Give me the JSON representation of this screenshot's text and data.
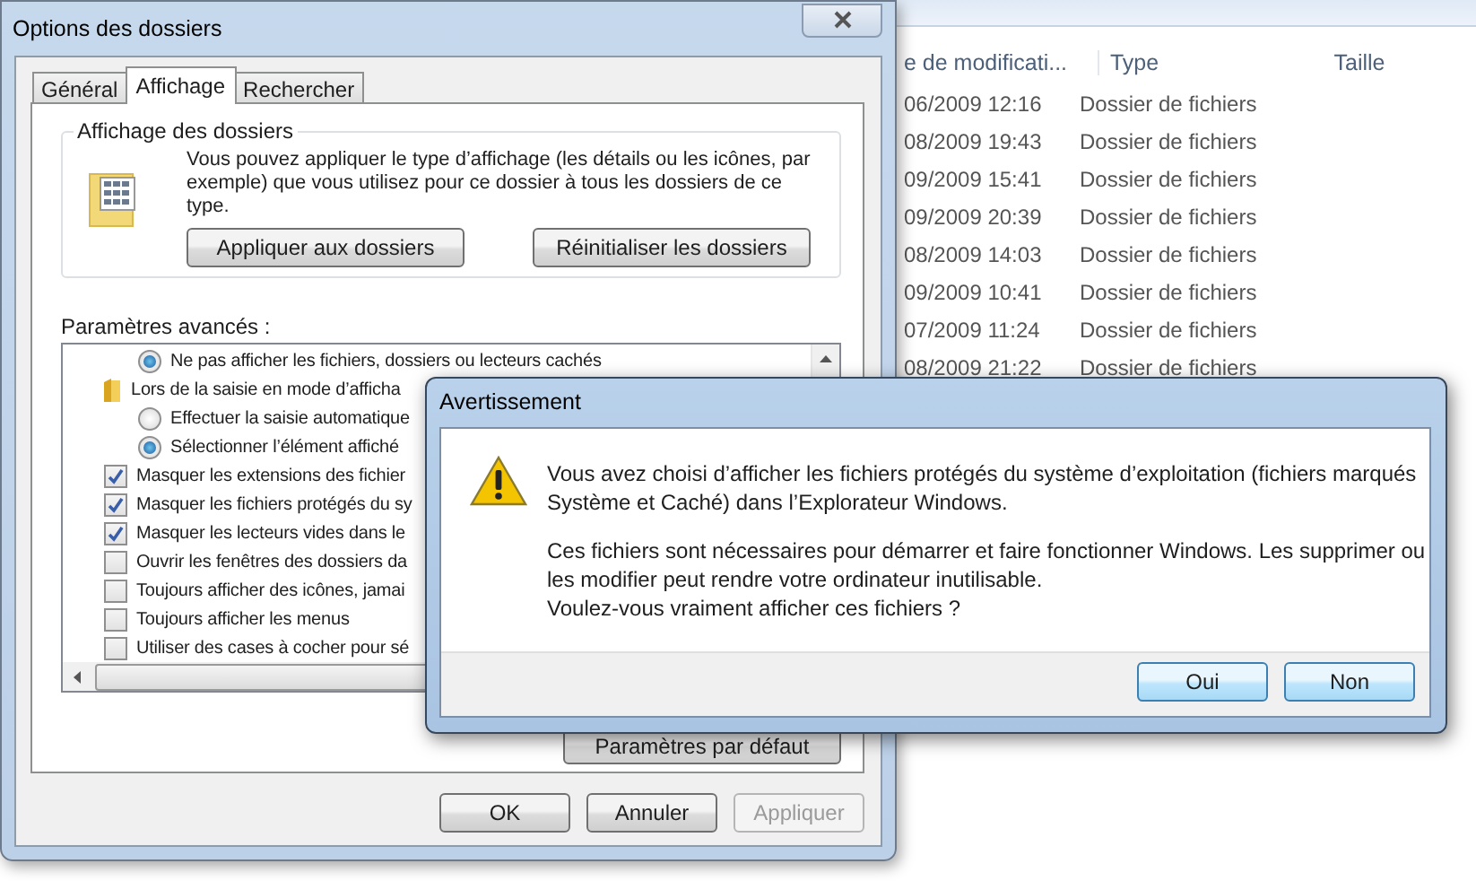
{
  "explorer": {
    "columns": [
      "e de modificati...",
      "Type",
      "Taille"
    ],
    "rows": [
      {
        "date": "06/2009 12:16",
        "type": "Dossier de fichiers"
      },
      {
        "date": "08/2009 19:43",
        "type": "Dossier de fichiers"
      },
      {
        "date": "09/2009 15:41",
        "type": "Dossier de fichiers"
      },
      {
        "date": "09/2009 20:39",
        "type": "Dossier de fichiers"
      },
      {
        "date": "08/2009 14:03",
        "type": "Dossier de fichiers"
      },
      {
        "date": "09/2009 10:41",
        "type": "Dossier de fichiers"
      },
      {
        "date": "07/2009 11:24",
        "type": "Dossier de fichiers"
      },
      {
        "date": "08/2009 21:22",
        "type": "Dossier de fichiers"
      }
    ]
  },
  "folder_options": {
    "title": "Options des dossiers",
    "tabs": [
      {
        "label": "Général",
        "selected": false
      },
      {
        "label": "Affichage",
        "selected": true
      },
      {
        "label": "Rechercher",
        "selected": false
      }
    ],
    "group": {
      "title": "Affichage des dossiers",
      "text": "Vous pouvez appliquer le type d’affichage (les détails ou les icônes, par exemple) que vous utilisez pour ce dossier à tous les dossiers de ce type.",
      "buttons": [
        "Appliquer aux dossiers",
        "Réinitialiser les dossiers"
      ]
    },
    "advanced_label": "Paramètres avancés :",
    "settings": [
      {
        "kind": "radio",
        "label": "Ne pas afficher les fichiers, dossiers ou lecteurs cachés",
        "checked": true
      },
      {
        "kind": "folder",
        "label": "Lors de la saisie en mode d’afficha"
      },
      {
        "kind": "radio",
        "label": "Effectuer la saisie automatique",
        "checked": false
      },
      {
        "kind": "radio",
        "label": "Sélectionner l’élément affiché",
        "checked": true
      },
      {
        "kind": "checkbox",
        "label": "Masquer les extensions des fichier",
        "checked": true
      },
      {
        "kind": "checkbox",
        "label": "Masquer les fichiers protégés du sy",
        "checked": true
      },
      {
        "kind": "checkbox",
        "label": "Masquer les lecteurs vides dans le",
        "checked": true
      },
      {
        "kind": "checkbox",
        "label": "Ouvrir les fenêtres des dossiers da",
        "checked": false
      },
      {
        "kind": "checkbox",
        "label": "Toujours afficher des icônes, jamai",
        "checked": false
      },
      {
        "kind": "checkbox",
        "label": "Toujours afficher les menus",
        "checked": false
      },
      {
        "kind": "checkbox",
        "label": "Utiliser des cases à cocher pour sé",
        "checked": false
      }
    ],
    "default_button": "Paramètres par défaut",
    "buttons": [
      {
        "label": "OK",
        "disabled": false
      },
      {
        "label": "Annuler",
        "disabled": false
      },
      {
        "label": "Appliquer",
        "disabled": true
      }
    ]
  },
  "warning": {
    "title": "Avertissement",
    "paragraphs": [
      "Vous avez choisi d’afficher les fichiers protégés du système d’exploitation (fichiers marqués\nSystème et Caché) dans l’Explorateur Windows.",
      "Ces fichiers sont nécessaires pour démarrer et faire fonctionner Windows. Les supprimer ou\nles modifier peut rendre votre ordinateur inutilisable.",
      "Voulez-vous vraiment afficher ces fichiers ?"
    ],
    "buttons": [
      "Oui",
      "Non"
    ]
  }
}
